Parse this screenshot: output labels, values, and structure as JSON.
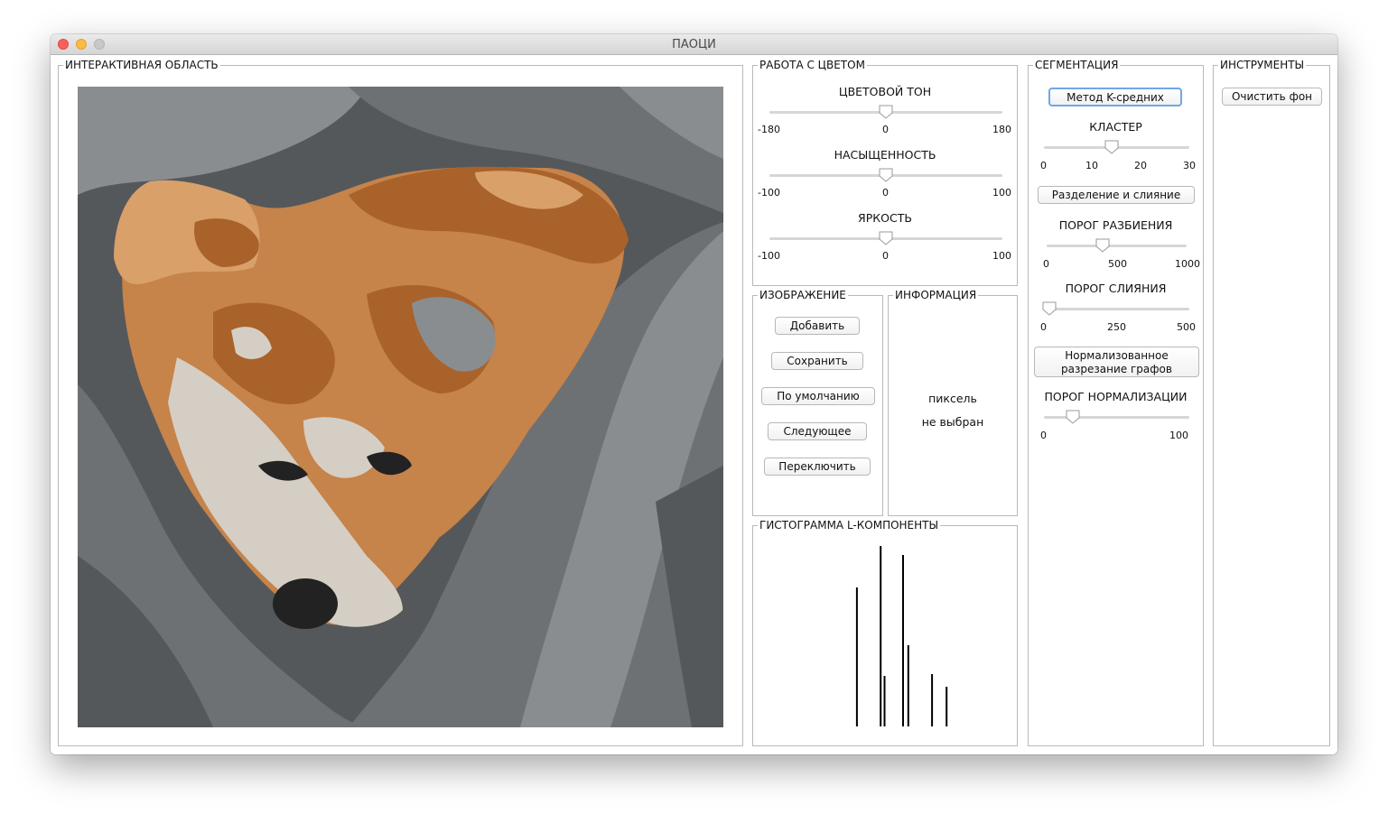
{
  "window": {
    "title": "ПАОЦИ"
  },
  "interactive": {
    "title": "ИНТЕРАКТИВНАЯ ОБЛАСТЬ"
  },
  "color": {
    "title": "РАБОТА С ЦВЕТОМ",
    "hue": {
      "label": "ЦВЕТОВОЙ ТОН",
      "min": "-180",
      "mid": "0",
      "max": "180",
      "value": 0
    },
    "saturation": {
      "label": "НАСЫЩЕННОСТЬ",
      "min": "-100",
      "mid": "0",
      "max": "100",
      "value": 0
    },
    "brightness": {
      "label": "ЯРКОСТЬ",
      "min": "-100",
      "mid": "0",
      "max": "100",
      "value": 0
    }
  },
  "image": {
    "title": "ИЗОБРАЖЕНИЕ",
    "add": "Добавить",
    "save": "Сохранить",
    "default": "По умолчанию",
    "next": "Следующее",
    "toggle": "Переключить"
  },
  "info": {
    "title": "ИНФОРМАЦИЯ",
    "line1": "пиксель",
    "line2": "не выбран"
  },
  "histogram": {
    "title": "ГИСТОГРАММА L-КОМПОНЕНТЫ",
    "bars": [
      {
        "pos": 0.39,
        "value": 0.77
      },
      {
        "pos": 0.48,
        "value": 1.0
      },
      {
        "pos": 0.495,
        "value": 0.28
      },
      {
        "pos": 0.565,
        "value": 0.95
      },
      {
        "pos": 0.585,
        "value": 0.45
      },
      {
        "pos": 0.675,
        "value": 0.29
      },
      {
        "pos": 0.73,
        "value": 0.22
      }
    ]
  },
  "segmentation": {
    "title": "СЕГМЕНТАЦИЯ",
    "kmeans": "Метод K-средних",
    "cluster": {
      "label": "КЛАСТЕР",
      "ticks": [
        "0",
        "10",
        "20",
        "30"
      ],
      "value": 14
    },
    "split_merge": "Разделение и слияние",
    "split_threshold": {
      "label": "ПОРОГ РАЗБИЕНИЯ",
      "ticks": [
        "0",
        "500",
        "1000"
      ],
      "value": 400
    },
    "merge_threshold": {
      "label": "ПОРОГ СЛИЯНИЯ",
      "ticks": [
        "0",
        "250",
        "500"
      ],
      "value": 20
    },
    "normalized_cut": "Нормализованное разрезание графов",
    "norm_threshold": {
      "label": "ПОРОГ НОРМАЛИЗАЦИИ",
      "ticks": [
        "0",
        "100"
      ],
      "value": 20
    }
  },
  "tools": {
    "title": "ИНСТРУМЕНТЫ",
    "clear_bg": "Очистить фон"
  },
  "colors": {
    "bg_dark": "#55585a",
    "bg_mid": "#6e7173",
    "bg_light": "#8a8d8f",
    "fur_dark": "#a9622a",
    "fur_mid": "#c6834a",
    "fur_light": "#d9a06a",
    "cream": "#d5cec4",
    "nose": "#222222"
  }
}
